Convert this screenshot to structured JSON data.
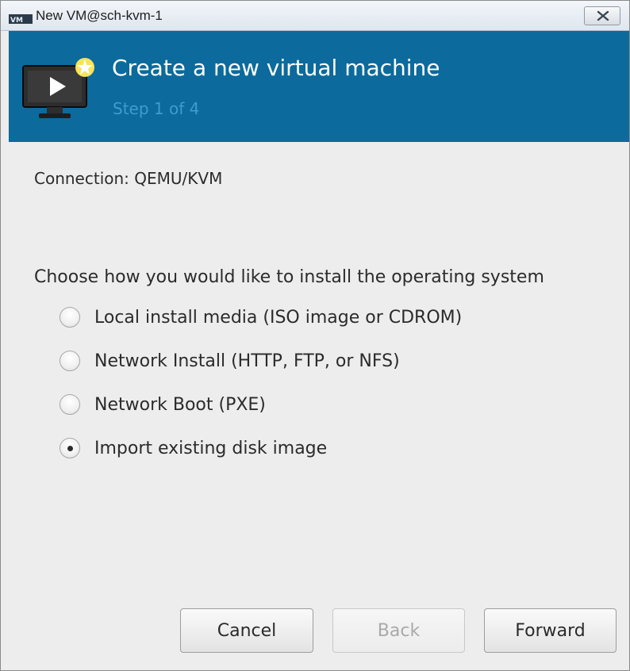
{
  "window": {
    "title": "New VM@sch-kvm-1",
    "app_icon": "virt-manager-icon",
    "close_icon": "close-icon"
  },
  "header": {
    "title": "Create a new virtual machine",
    "step": "Step 1 of 4",
    "icon": "new-vm-monitor-icon",
    "background_color": "#0c6a9c"
  },
  "connection": {
    "text": "Connection: QEMU/KVM"
  },
  "install": {
    "prompt": "Choose how you would like to install the operating system",
    "options": [
      {
        "label": "Local install media (ISO image or CDROM)",
        "selected": false
      },
      {
        "label": "Network Install (HTTP, FTP, or NFS)",
        "selected": false
      },
      {
        "label": "Network Boot (PXE)",
        "selected": false
      },
      {
        "label": "Import existing disk image",
        "selected": true
      }
    ]
  },
  "buttons": {
    "cancel": "Cancel",
    "back": "Back",
    "forward": "Forward"
  }
}
